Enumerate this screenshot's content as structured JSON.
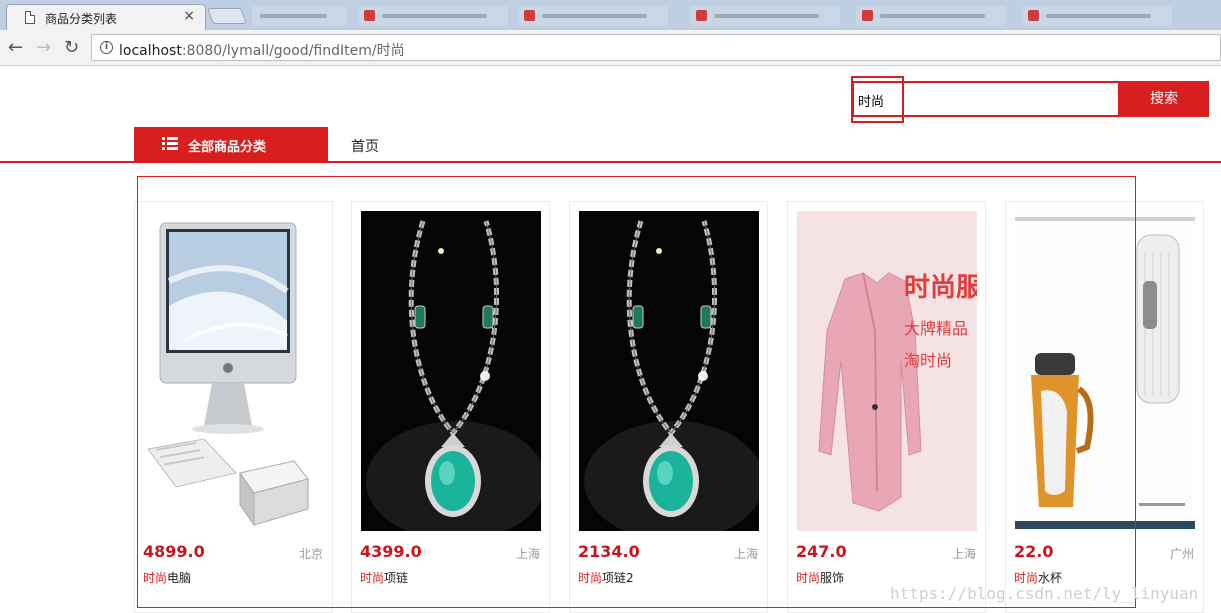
{
  "browser": {
    "active_tab": {
      "title": "商品分类列表",
      "close_glyph": "×"
    },
    "url": {
      "host": "localhost",
      "rest": ":8080/lymall/good/findItem/时尚"
    }
  },
  "search": {
    "value": "时尚",
    "button_label": "搜索"
  },
  "nav": {
    "category_label": "全部商品分类",
    "home_label": "首页"
  },
  "products": [
    {
      "price": "4899.0",
      "city": "北京",
      "keyword": "时尚",
      "name": "电脑",
      "image": "computer"
    },
    {
      "price": "4399.0",
      "city": "上海",
      "keyword": "时尚",
      "name": "项链",
      "image": "necklace"
    },
    {
      "price": "2134.0",
      "city": "上海",
      "keyword": "时尚",
      "name": "项链2",
      "image": "necklace"
    },
    {
      "price": "247.0",
      "city": "上海",
      "keyword": "时尚",
      "name": "服饰",
      "image": "clothing"
    },
    {
      "price": "22.0",
      "city": "广州",
      "keyword": "时尚",
      "name": "水杯",
      "image": "cup"
    }
  ],
  "clothing_ad": {
    "title": "时尚服饰",
    "line1": "大牌精品",
    "line2": "淘时尚"
  },
  "watermark": "https://blog.csdn.net/ly_linyuan",
  "colors": {
    "accent": "#d81e1e",
    "price": "#c8161d"
  }
}
